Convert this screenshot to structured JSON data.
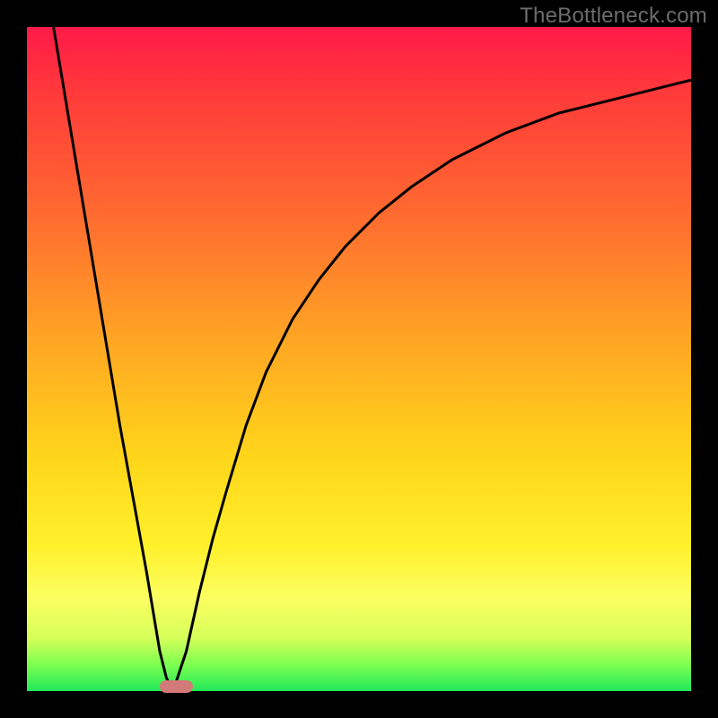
{
  "watermark": "TheBottleneck.com",
  "chart_data": {
    "type": "line",
    "title": "",
    "xlabel": "",
    "ylabel": "",
    "xlim": [
      0,
      100
    ],
    "ylim": [
      0,
      100
    ],
    "grid": false,
    "legend": false,
    "series": [
      {
        "name": "left-branch",
        "x": [
          4,
          6,
          8,
          10,
          12,
          14,
          16,
          18,
          20,
          21,
          22
        ],
        "y": [
          100,
          88,
          76,
          64,
          52,
          40,
          29,
          18,
          6,
          2,
          0
        ]
      },
      {
        "name": "right-branch",
        "x": [
          22,
          24,
          26,
          28,
          30,
          33,
          36,
          40,
          44,
          48,
          53,
          58,
          64,
          72,
          80,
          88,
          96,
          100
        ],
        "y": [
          0,
          6,
          15,
          23,
          30,
          40,
          48,
          56,
          62,
          67,
          72,
          76,
          80,
          84,
          87,
          89,
          91,
          92
        ]
      }
    ],
    "marker": {
      "name": "optimal-range",
      "x_start": 20,
      "x_end": 25,
      "y": 0,
      "color": "#d17a78"
    }
  }
}
